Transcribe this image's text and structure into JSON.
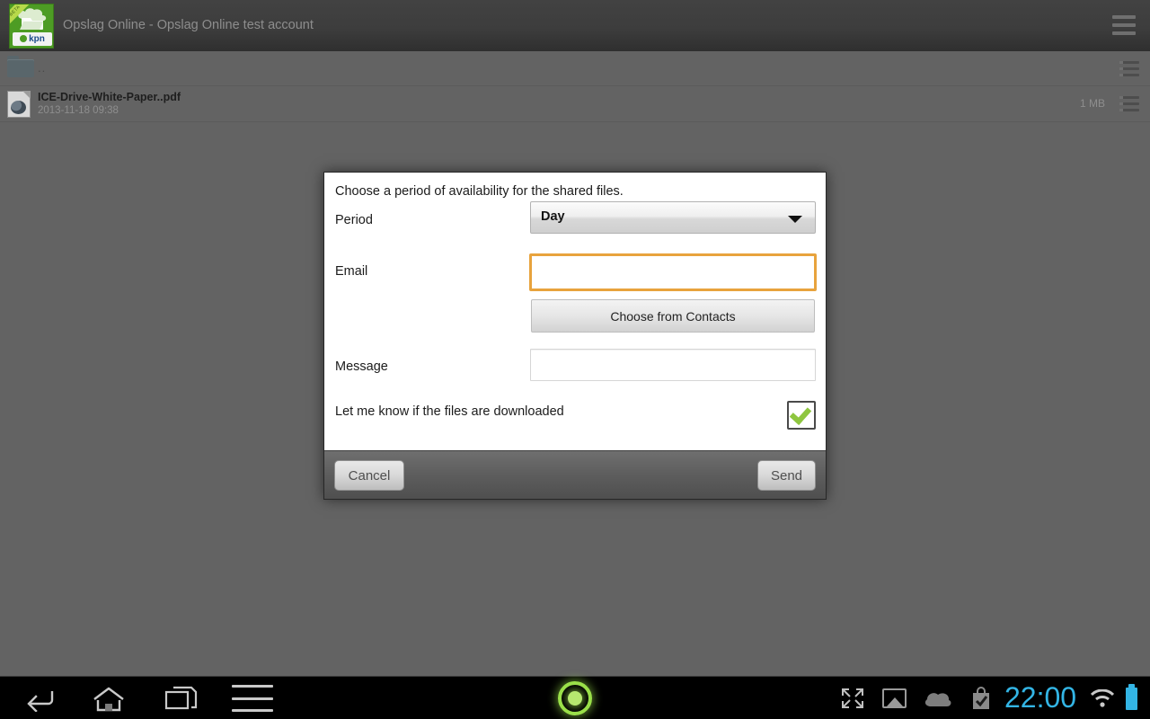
{
  "titlebar": {
    "app_title": "Opslag Online - Opslag Online test account",
    "icon_name": "cloud-folder-icon",
    "icon_ribbon": "BETA",
    "icon_brand": "kpn",
    "menu_label": "menu"
  },
  "filelist": {
    "rows": [
      {
        "type": "folder",
        "name": "..",
        "subtitle": "",
        "size": ""
      },
      {
        "type": "file",
        "name": "ICE-Drive-White-Paper..pdf",
        "subtitle": "2013-11-18 09:38",
        "size": "1 MB"
      }
    ]
  },
  "dialog": {
    "prompt": "Choose a period of availability for the shared files.",
    "period_label": "Period",
    "period_value": "Day",
    "email_label": "Email",
    "email_value": "",
    "email_placeholder": "",
    "contacts_button": "Choose from Contacts",
    "message_label": "Message",
    "message_value": "",
    "message_placeholder": "",
    "notify_label": "Let me know if the files are downloaded",
    "notify_checked": true,
    "cancel_button": "Cancel",
    "send_button": "Send"
  },
  "systembar": {
    "back": "back",
    "home": "home",
    "recents": "recent apps",
    "menu": "menu",
    "status_led": "recording-indicator",
    "tray": {
      "expand": "fullscreen-icon",
      "screenshot": "image-icon",
      "cloud": "cloud-icon",
      "playstore": "play-store-icon",
      "clock": "22:00",
      "wifi": "wifi-icon",
      "battery": "battery-icon"
    }
  },
  "colors": {
    "accent_focus": "#e8a33d",
    "brand_green": "#4d9c24",
    "check_green": "#8ec63f",
    "clock_blue": "#33b5e5",
    "titlebar": "#3d3d3d",
    "content_bg": "#636363"
  }
}
